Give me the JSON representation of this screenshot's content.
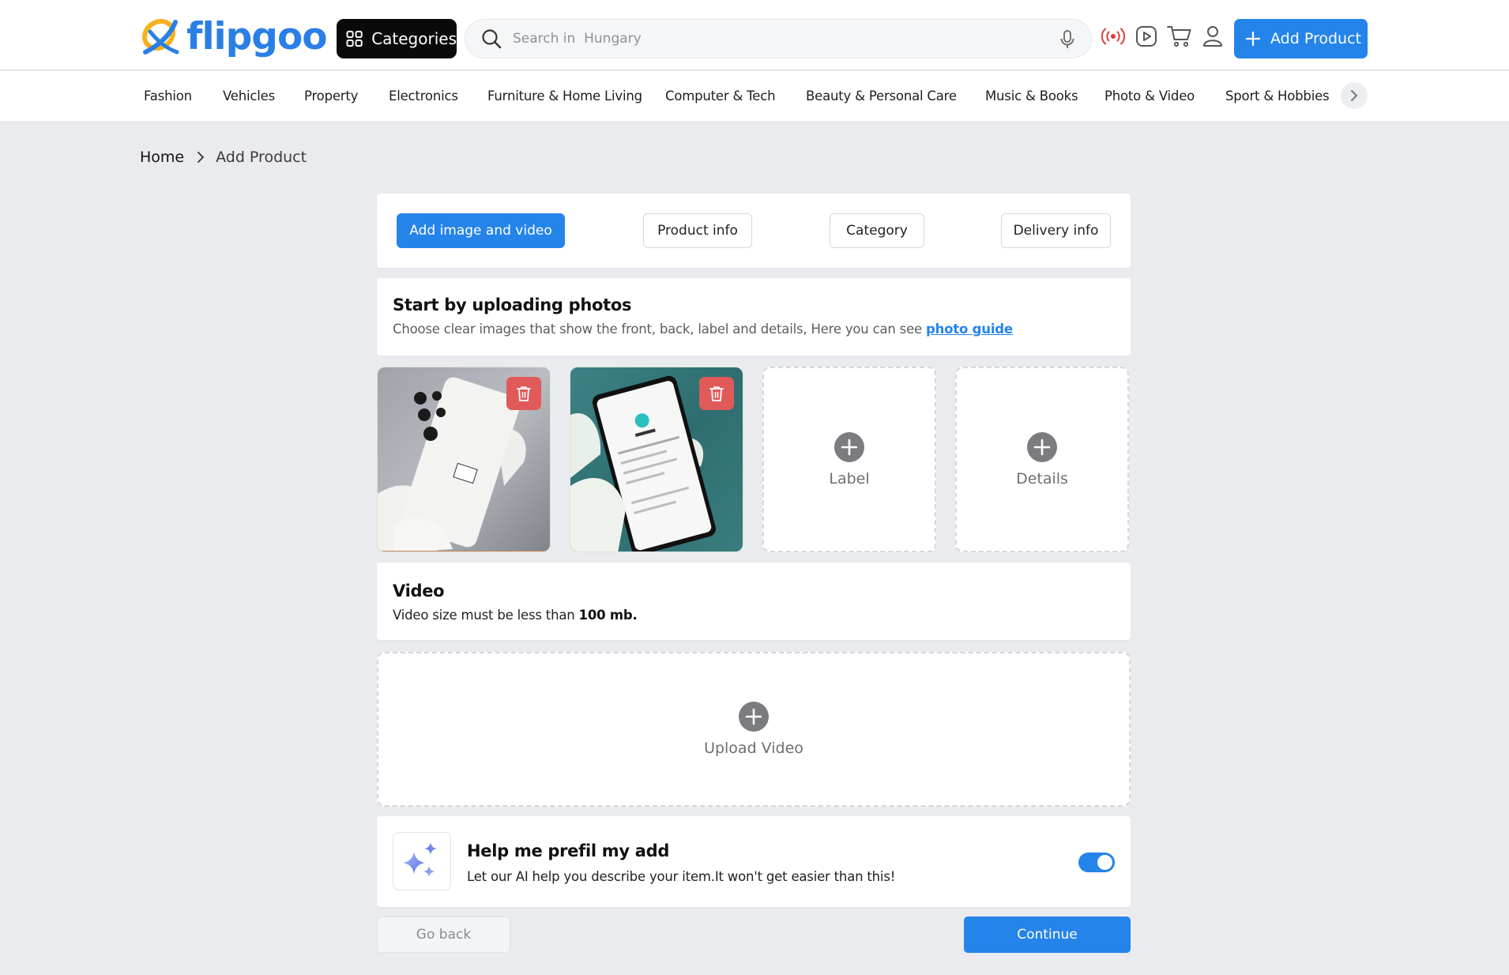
{
  "header": {
    "logo_text": "flipgoo",
    "categories_label": "Categories",
    "search_placeholder": "Search in  Hungary",
    "add_product_label": "Add Product",
    "icons": [
      "live-icon",
      "play-video-icon",
      "cart-icon",
      "user-icon"
    ]
  },
  "nav": {
    "items": [
      "Fashion",
      "Vehicles",
      "Property",
      "Electronics",
      "Furniture & Home Living",
      "Computer & Tech",
      "Beauty & Personal Care",
      "Music & Books",
      "Photo & Video",
      "Sport & Hobbies"
    ]
  },
  "breadcrumb": {
    "home": "Home",
    "current": "Add Product"
  },
  "steps": {
    "items": [
      "Add image and video",
      "Product info",
      "Category",
      "Delivery info"
    ],
    "active": "Add image and video"
  },
  "upload": {
    "title": "Start by uploading photos",
    "subtitle": "Choose clear images that show the front, back, label and details, Here you can see ",
    "guide_link": "photo guide",
    "slots": [
      "Label",
      "Details"
    ]
  },
  "video": {
    "title": "Video",
    "subtitle_prefix": "Video size must be less than ",
    "size_limit": "100 mb.",
    "upload_label": "Upload Video"
  },
  "ai": {
    "title": "Help me prefil my add",
    "subtitle": "Let our AI help you describe your item.It won't get easier than this!",
    "toggle_on": true
  },
  "footer": {
    "back_label": "Go back",
    "continue_label": "Continue"
  },
  "colors": {
    "primary": "#2484ea",
    "danger": "#e05a5a",
    "logo_yellow": "#f5b21f",
    "live_red": "#e03b3b"
  }
}
